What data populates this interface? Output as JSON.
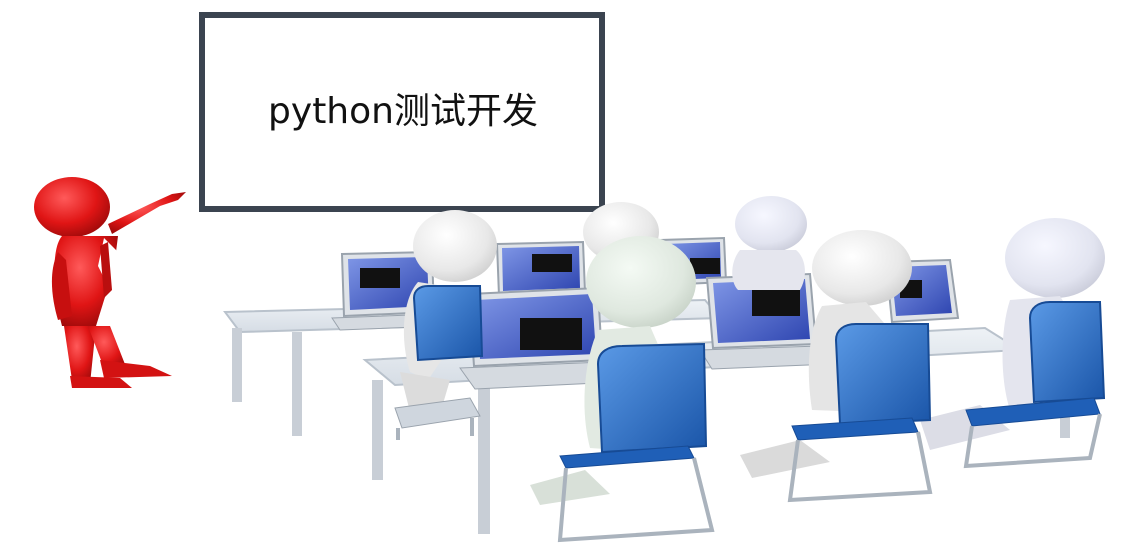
{
  "whiteboard": {
    "text": "python测试开发"
  },
  "colors": {
    "presenter": "#e11a1a",
    "figure": "#eeeeee",
    "chair": "#2a72c8",
    "laptop_screen": "#3f5bc8",
    "board_frame": "#3b4450"
  },
  "icons": {
    "presenter": "presenter-figure",
    "students": "student-figure",
    "laptops": "laptop-icon",
    "chairs": "office-chair-icon"
  }
}
